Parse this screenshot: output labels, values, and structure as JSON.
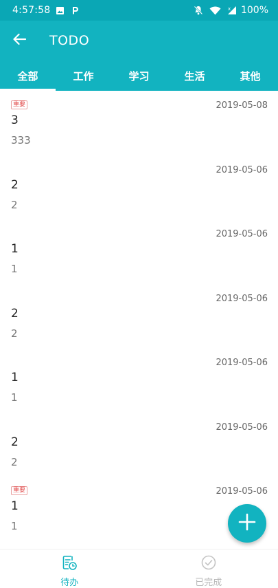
{
  "status_bar": {
    "time": "4:57:58",
    "battery": "100%",
    "icons": [
      "image-icon",
      "p-app-icon",
      "bell-muted-icon",
      "wifi-icon",
      "signal-icon",
      "battery-icon"
    ]
  },
  "app_bar": {
    "back_icon": "arrow-left-icon",
    "title": "TODO"
  },
  "tabs": [
    {
      "label": "全部",
      "active": true
    },
    {
      "label": "工作",
      "active": false
    },
    {
      "label": "学习",
      "active": false
    },
    {
      "label": "生活",
      "active": false
    },
    {
      "label": "其他",
      "active": false
    }
  ],
  "items": [
    {
      "tag": "重要",
      "date": "2019-05-08",
      "title": "3",
      "body": "333"
    },
    {
      "tag": "",
      "date": "2019-05-06",
      "title": "2",
      "body": "2"
    },
    {
      "tag": "",
      "date": "2019-05-06",
      "title": "1",
      "body": "1"
    },
    {
      "tag": "",
      "date": "2019-05-06",
      "title": "2",
      "body": "2"
    },
    {
      "tag": "",
      "date": "2019-05-06",
      "title": "1",
      "body": "1"
    },
    {
      "tag": "",
      "date": "2019-05-06",
      "title": "2",
      "body": "2"
    },
    {
      "tag": "重要",
      "date": "2019-05-06",
      "title": "1",
      "body": "1"
    }
  ],
  "fab": {
    "icon": "plus-icon"
  },
  "bottom_nav": [
    {
      "label": "待办",
      "icon": "todo-list-icon",
      "active": true
    },
    {
      "label": "已完成",
      "icon": "check-circle-icon",
      "active": false
    }
  ],
  "colors": {
    "primary": "#12b3c0",
    "status_bar": "#0aa7b5",
    "tag_red": "#e24a4a",
    "inactive": "#b8b8b8"
  }
}
